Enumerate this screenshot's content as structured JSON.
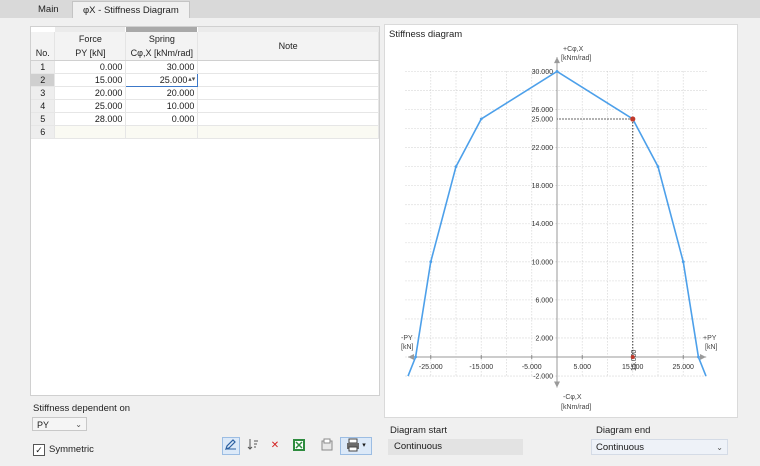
{
  "tabs": [
    "Main",
    "φX - Stiffness Diagram"
  ],
  "table": {
    "headers": {
      "no": "No.",
      "force_top": "Force",
      "force_sub": "PY [kN]",
      "spring_top": "Spring",
      "spring_sub": "Cφ,X [kNm/rad]",
      "note": "Note"
    },
    "rows": [
      {
        "no": "1",
        "force": "0.000",
        "spring": "30.000",
        "note": ""
      },
      {
        "no": "2",
        "force": "15.000",
        "spring": "25.000",
        "note": ""
      },
      {
        "no": "3",
        "force": "20.000",
        "spring": "20.000",
        "note": ""
      },
      {
        "no": "4",
        "force": "25.000",
        "spring": "10.000",
        "note": ""
      },
      {
        "no": "5",
        "force": "28.000",
        "spring": "0.000",
        "note": ""
      },
      {
        "no": "6",
        "force": "",
        "spring": "",
        "note": ""
      }
    ],
    "spinner_icon": "spinner-updown-icon"
  },
  "stiffness": {
    "label": "Stiffness dependent on",
    "value": "PY",
    "symmetric_label": "Symmetric",
    "symmetric_checked": true
  },
  "toolbar_icons": [
    "edit-diagram-icon",
    "sort-icon",
    "delete-icon",
    "excel-icon",
    "copy-icon",
    "print-icon"
  ],
  "chart_title": "Stiffness diagram",
  "chart_data": {
    "type": "line",
    "title": "Stiffness diagram",
    "x_axis": {
      "label_pos": "+PY",
      "label_neg": "-PY",
      "unit": "[kN]",
      "range": [
        -30,
        30
      ],
      "ticks": [
        -25.0,
        -15.0,
        -5.0,
        5.0,
        15.0,
        25.0
      ],
      "tick_labels": [
        "-25.000",
        "-15.000",
        "-5.000",
        "5.000",
        "15.000",
        "25.000"
      ]
    },
    "y_axis": {
      "label_pos": "+Cφ,X",
      "label_neg": "-Cφ,X",
      "unit": "[kNm/rad]",
      "range": [
        -2,
        30
      ],
      "ticks": [
        -2,
        2,
        6,
        10,
        14,
        18,
        22,
        25,
        26,
        30
      ],
      "tick_labels": [
        "-2.000",
        "2.000",
        "6.000",
        "10.000",
        "14.000",
        "18.000",
        "22.000",
        "25.000",
        "26.000",
        "30.000"
      ]
    },
    "series": [
      {
        "x": [
          -28,
          -25,
          -20,
          -15,
          0,
          15,
          20,
          25,
          28
        ],
        "y": [
          0,
          10,
          20,
          25,
          30,
          25,
          20,
          10,
          0
        ]
      }
    ],
    "cursor_label": "15.000",
    "highlight_point": {
      "x": 15,
      "y": 25
    },
    "extend_x": [
      -29.5,
      29.5
    ],
    "extend_y": [
      -2.0,
      -2.0
    ],
    "grid": true,
    "line_color": "#4da0ea",
    "point_color": "#c0392b"
  },
  "diagram_start": {
    "label": "Diagram start",
    "value": "Continuous"
  },
  "diagram_end": {
    "label": "Diagram end",
    "value": "Continuous"
  }
}
